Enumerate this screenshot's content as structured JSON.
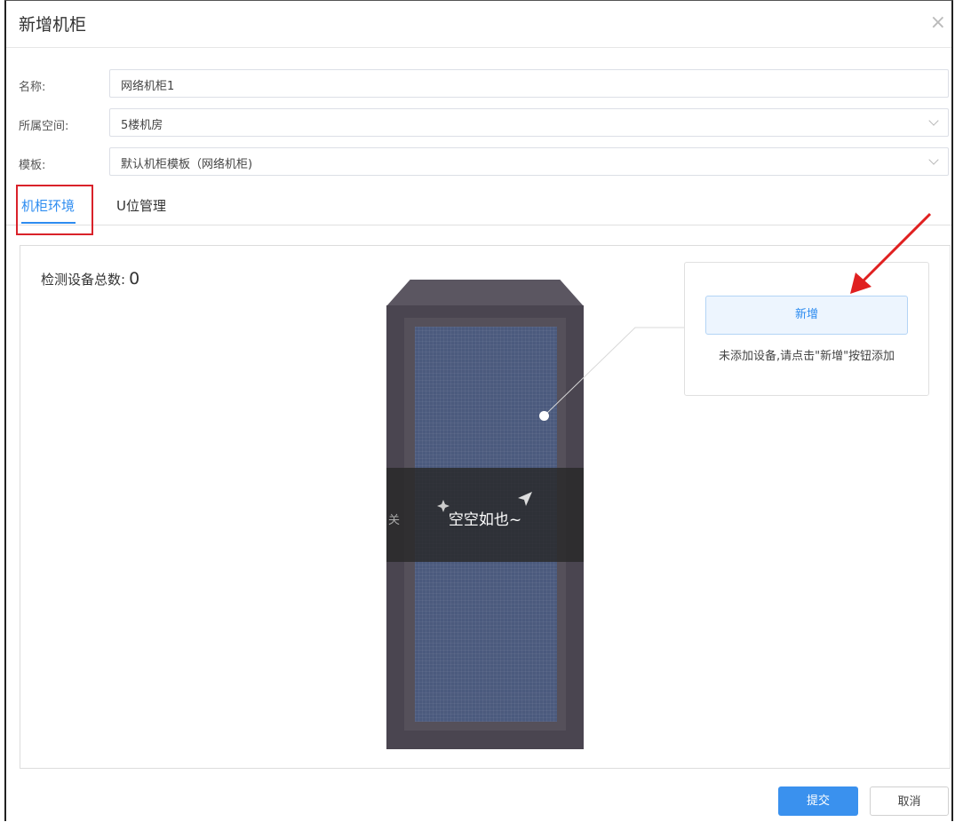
{
  "dialog": {
    "title": "新增机柜",
    "close_icon": "×"
  },
  "form": {
    "name_label": "名称:",
    "name_value": "网络机柜1",
    "space_label": "所属空间:",
    "space_value": "5楼机房",
    "template_label": "模板:",
    "template_value": "默认机柜模板（网络机柜)"
  },
  "tabs": [
    {
      "label": "机柜环境",
      "active": true
    },
    {
      "label": "U位管理",
      "active": false
    }
  ],
  "panel": {
    "count_label": "检测设备总数:",
    "count_value": "0",
    "empty_text": "空空如也~",
    "side_label": "关",
    "add_button": "新增",
    "hint": "未添加设备,请点击\"新增\"按钮添加"
  },
  "footer": {
    "submit": "提交",
    "cancel": "取消"
  },
  "colors": {
    "accent": "#2d8cf0",
    "highlight_box": "#d9222a",
    "arrow": "#e02020"
  }
}
